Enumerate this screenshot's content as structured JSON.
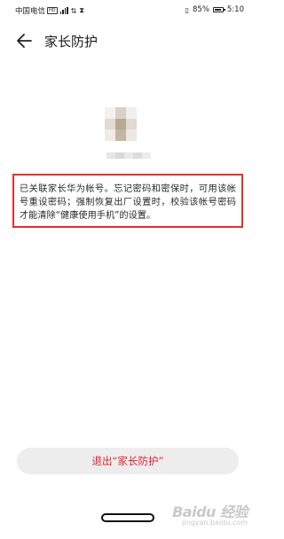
{
  "status_bar": {
    "carrier": "中国电信",
    "hd": "HD",
    "battery": "85%",
    "battery_level": 0.85,
    "time": "5:10"
  },
  "header": {
    "title": "家长防护"
  },
  "notice": {
    "text": "已关联家长华为帐号。忘记密码和密保时，可用该帐号重设密码；强制恢复出厂设置时，校验该帐号密码才能清除“健康使用手机”的设置。"
  },
  "actions": {
    "exit_label": "退出“家长防护”"
  },
  "watermark": {
    "brand": "Baidu 经验",
    "url": "jingyan.baidu.com"
  },
  "colors": {
    "accent_red": "#e1202d",
    "highlight_border": "#e3322a",
    "button_bg": "#ededed"
  }
}
